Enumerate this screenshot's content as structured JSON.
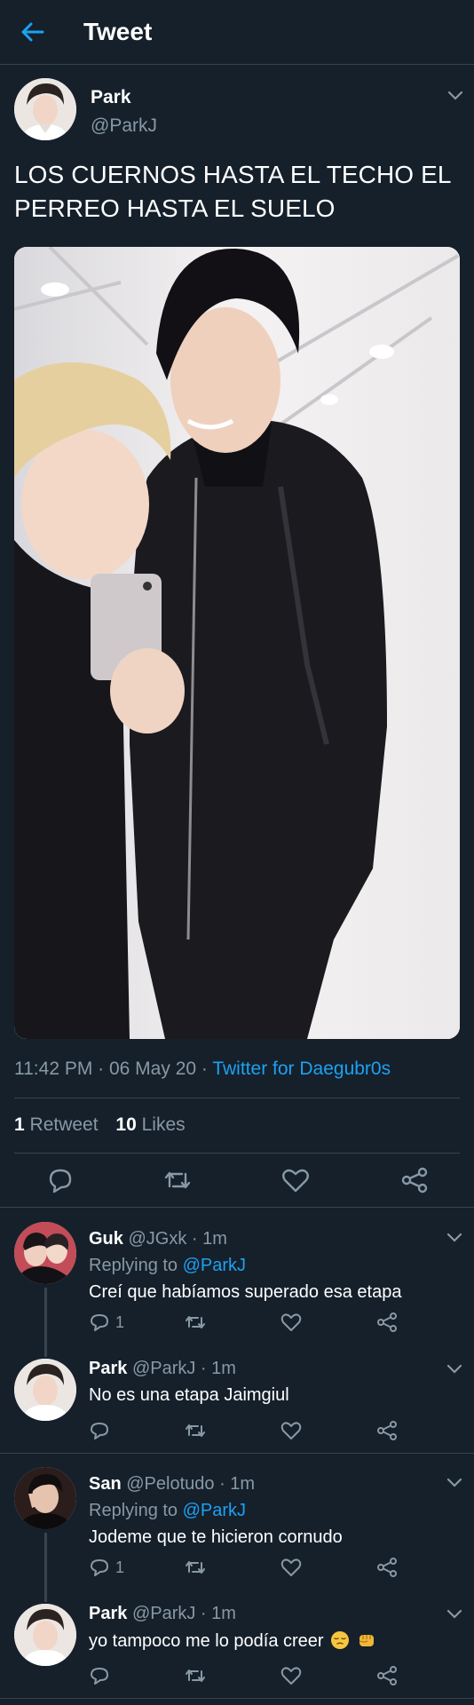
{
  "header": {
    "title": "Tweet",
    "back_icon": "arrow-left-icon"
  },
  "colors": {
    "background": "#15202b",
    "accent": "#1da1f2",
    "muted": "#8899a6",
    "divider": "#38444d"
  },
  "tweet": {
    "author_name": "Park",
    "author_handle": "@ParkJ",
    "text": "LOS CUERNOS HASTA EL TECHO EL PERREO HASTA EL SUELO",
    "time_date": "11:42 PM · 06 May 20 · ",
    "source": "Twitter for Daegubr0s",
    "retweet_count": "1",
    "retweet_label": "Retweet",
    "like_count": "10",
    "like_label": "Likes"
  },
  "replies": [
    {
      "name": "Guk",
      "handle_time": "@JGxk · 1m",
      "replying_prefix": "Replying to ",
      "replying_to": "@ParkJ",
      "text": "Creí que habíamos superado esa etapa",
      "reply_count": "1"
    },
    {
      "name": "Park",
      "handle_time": "@ParkJ · 1m",
      "text": "No es una etapa Jaimgiul",
      "reply_count": ""
    },
    {
      "name": "San",
      "handle_time": "@Pelotudo · 1m",
      "replying_prefix": "Replying to ",
      "replying_to": "@ParkJ",
      "text": "Jodeme que te hicieron cornudo",
      "reply_count": "1"
    },
    {
      "name": "Park",
      "handle_time": "@ParkJ · 1m",
      "text": "yo tampoco me lo podía creer",
      "emojis": [
        "pensive-face-emoji",
        "fist-emoji"
      ],
      "reply_count": ""
    }
  ]
}
